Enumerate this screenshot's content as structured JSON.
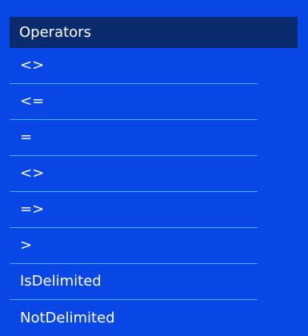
{
  "header": {
    "title": "Operators"
  },
  "operators": [
    "<>",
    "<=",
    "=",
    "<>",
    "=>",
    ">",
    "IsDelimited",
    "NotDelimited"
  ],
  "colors": {
    "background": "#0846e6",
    "header_background": "#0a2c6f",
    "divider": "#3fb6ff",
    "text": "#ffffff"
  }
}
